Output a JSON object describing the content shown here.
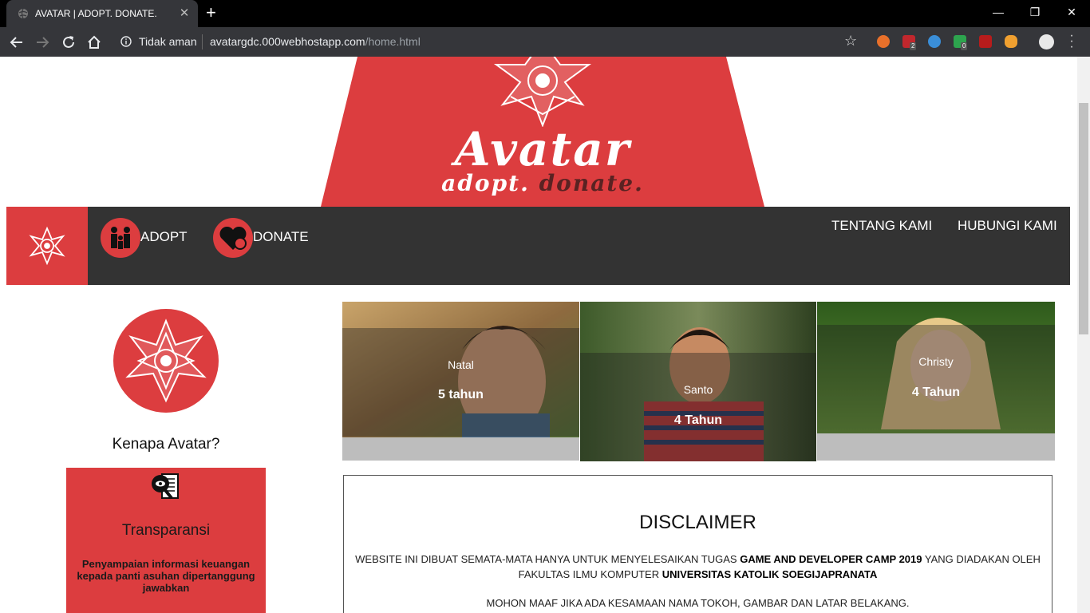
{
  "browser": {
    "tab_title": "AVATAR | ADOPT. DONATE.",
    "security_label": "Tidak aman",
    "url_host": "avatargdc.000webhostapp.com",
    "url_path": "/home.html",
    "extension_badges": [
      "2",
      "0"
    ]
  },
  "hero": {
    "logo_text": "Avatar",
    "tagline_part1": "adopt.",
    "tagline_part2": "donate."
  },
  "nav": {
    "adopt": "ADOPT",
    "donate": "DONATE",
    "about": "TENTANG KAMI",
    "contact": "HUBUNGI KAMI"
  },
  "sidebar": {
    "heading": "Kenapa Avatar?",
    "card": {
      "title": "Transparansi",
      "text": "Penyampaian informasi keuangan kepada panti asuhan dipertanggung jawabkan"
    }
  },
  "children": [
    {
      "name": "Natal",
      "age": "5 tahun"
    },
    {
      "name": "Santo",
      "age": "4 Tahun"
    },
    {
      "name": "Christy",
      "age": "4 Tahun"
    }
  ],
  "disclaimer": {
    "title": "DISCLAIMER",
    "line1_part1": "WEBSITE INI DIBUAT SEMATA-MATA HANYA UNTUK MENYELESAIKAN TUGAS ",
    "line1_bold1": "GAME AND DEVELOPER CAMP 2019",
    "line1_part2": " YANG DIADAKAN OLEH FAKULTAS ILMU KOMPUTER ",
    "line1_bold2": "UNIVERSITAS KATOLIK SOEGIJAPRANATA",
    "line2": "MOHON MAAF JIKA ADA KESAMAAN NAMA TOKOH, GAMBAR DAN LATAR BELAKANG."
  },
  "colors": {
    "brand_red": "#dc3d3f",
    "nav_dark": "#333333",
    "chrome_dark": "#35363a"
  }
}
